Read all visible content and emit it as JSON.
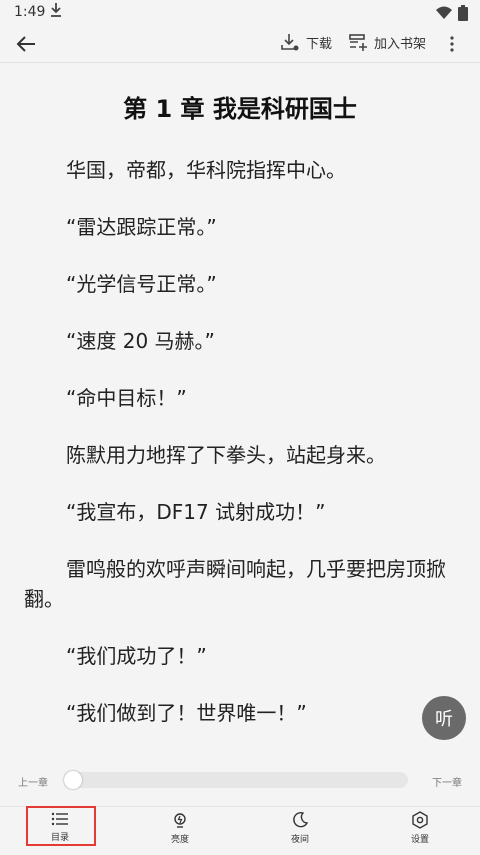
{
  "status_bar": {
    "time": "1:49"
  },
  "toolbar": {
    "download_label": "下载",
    "add_shelf_label": "加入书架"
  },
  "chapter": {
    "title": "第 1 章 我是科研国士",
    "paragraphs": [
      "华国，帝都，华科院指挥中心。",
      "“雷达跟踪正常。”",
      "“光学信号正常。”",
      "“速度 20 马赫。”",
      "“命中目标！”",
      "陈默用力地挥了下拳头，站起身来。",
      "“我宣布，DF17 试射成功！”",
      "雷鸣般的欢呼声瞬间响起，几乎要把房顶掀翻。",
      "“我们成功了！”",
      "“我们做到了！世界唯一！”"
    ]
  },
  "listen_label": "听",
  "progress": {
    "prev_label": "上一章",
    "next_label": "下一章",
    "value": 0
  },
  "bottom_bar": {
    "toc_label": "目录",
    "brightness_label": "亮度",
    "night_label": "夜间",
    "settings_label": "设置"
  }
}
